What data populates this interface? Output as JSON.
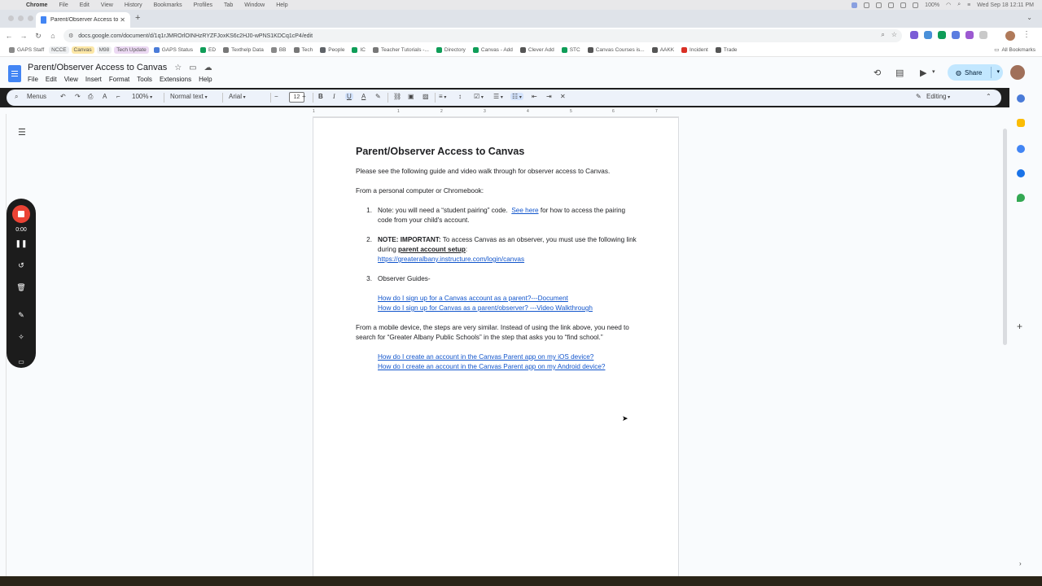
{
  "mac_menubar": {
    "items": [
      "Chrome",
      "File",
      "Edit",
      "View",
      "History",
      "Bookmarks",
      "Profiles",
      "Tab",
      "Window",
      "Help"
    ],
    "battery": "100%",
    "clock": "Wed Sep 18  12:11 PM"
  },
  "browser": {
    "tab_title": "Parent/Observer Access to C",
    "url": "docs.google.com/document/d/1q1rJMROrlOINHzRYZFJoxKS6c2HJ0-wPNS1KDCq1cP4/edit",
    "bookmarks": [
      {
        "label": "GAPS Staff",
        "style": "plain",
        "color": "#8a8a8a"
      },
      {
        "label": "NCCE",
        "style": "tag",
        "color": "#8a8a8a"
      },
      {
        "label": "Canvas",
        "style": "tag-y",
        "color": "#e08e2b"
      },
      {
        "label": "M98",
        "style": "tag",
        "color": "#8a8a8a"
      },
      {
        "label": "Tech Update",
        "style": "tag-p",
        "color": "#b06ad0"
      },
      {
        "label": "GAPS Status",
        "style": "plain",
        "color": "#4a7bd8"
      },
      {
        "label": "ED",
        "style": "plain",
        "color": "#0f9d58"
      },
      {
        "label": "Texthelp Data",
        "style": "plain",
        "color": "#777"
      },
      {
        "label": "BB",
        "style": "plain",
        "color": "#888"
      },
      {
        "label": "Tech",
        "style": "plain",
        "color": "#777"
      },
      {
        "label": "People",
        "style": "plain",
        "color": "#5f6368"
      },
      {
        "label": "IC",
        "style": "plain",
        "color": "#0f9d58"
      },
      {
        "label": "Teacher Tutorials -...",
        "style": "plain",
        "color": "#777"
      },
      {
        "label": "Directory",
        "style": "plain",
        "color": "#0f9d58"
      },
      {
        "label": "Canvas - Add",
        "style": "plain",
        "color": "#0f9d58"
      },
      {
        "label": "Clever Add",
        "style": "plain",
        "color": "#555"
      },
      {
        "label": "STC",
        "style": "plain",
        "color": "#0f9d58"
      },
      {
        "label": "Canvas Courses is...",
        "style": "plain",
        "color": "#555"
      },
      {
        "label": "AAKK",
        "style": "plain",
        "color": "#555"
      },
      {
        "label": "Incident",
        "style": "plain",
        "color": "#d93025"
      },
      {
        "label": "Trade",
        "style": "plain",
        "color": "#555"
      }
    ],
    "all_bookmarks": "All Bookmarks"
  },
  "docs": {
    "title": "Parent/Observer Access to Canvas",
    "menu": [
      "File",
      "Edit",
      "View",
      "Insert",
      "Format",
      "Tools",
      "Extensions",
      "Help"
    ],
    "share_label": "Share",
    "toolbar": {
      "menus_label": "Menus",
      "zoom": "100%",
      "style": "Normal text",
      "font": "Arial",
      "font_size": "12",
      "mode": "Editing"
    },
    "ruler_ticks": [
      "1",
      "1",
      "2",
      "3",
      "4",
      "5",
      "6",
      "7"
    ]
  },
  "document": {
    "heading": "Parent/Observer Access to Canvas",
    "intro": "Please see the following guide and video walk through for observer access to Canvas.",
    "from_computer": "From a personal computer or Chromebook:",
    "item1": {
      "num": "1.",
      "text_a": "Note: you will need a “student pairing” code.",
      "link": "See here",
      "text_b": "for how to access the pairing code from your child's account."
    },
    "item2": {
      "num": "2.",
      "bold": "NOTE: IMPORTANT:",
      "text_a": "To access Canvas as an observer, you must use the following link during",
      "bold_underline": "parent account setup",
      "text_b": ":",
      "link": "https://greateralbany.instructure.com/login/canvas"
    },
    "item3": {
      "num": "3.",
      "text": "Observer Guides-"
    },
    "guide_links": [
      "How do I sign up for a Canvas account as a parent?---Document",
      "How do I sign up for Canvas as a parent/observer? ---Video Walkthrough"
    ],
    "mobile_text": "From a mobile device, the steps are very similar.  Instead of using the link above, you need to search for “Greater Albany Public Schools” in the step that asks you to “find school.”",
    "mobile_links": [
      "How do I create an account in the Canvas Parent app on my iOS device?",
      "How do I create an account in the Canvas Parent app on my Android device?"
    ]
  },
  "recorder": {
    "time": "0:00",
    "accent": "#ea4335"
  },
  "colors": {
    "link": "#1155cc",
    "share_bg": "#c2e7ff",
    "toolbar_bg": "#edf2fa"
  }
}
